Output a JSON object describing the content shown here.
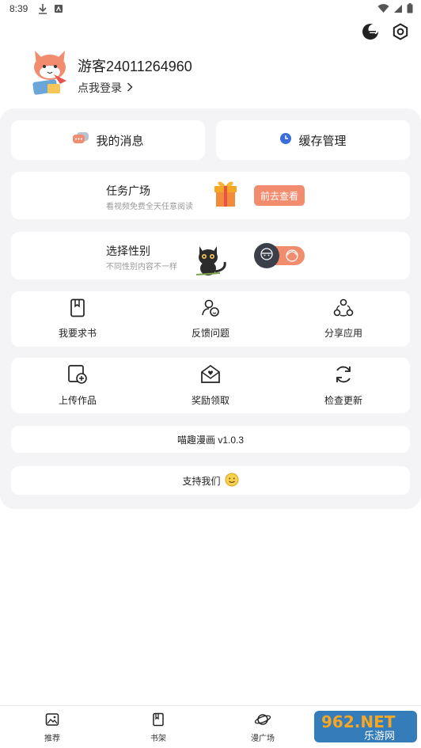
{
  "status": {
    "time": "8:39"
  },
  "profile": {
    "username": "游客24011264960",
    "login_label": "点我登录"
  },
  "quick": {
    "messages_label": "我的消息",
    "cache_label": "缓存管理"
  },
  "task": {
    "title": "任务广场",
    "subtitle": "看视频免费全天任意阅读",
    "button_label": "前去查看"
  },
  "gender": {
    "title": "选择性别",
    "subtitle": "不同性别内容不一样"
  },
  "grid1": [
    {
      "label": "我要求书",
      "icon": "book-icon"
    },
    {
      "label": "反馈问题",
      "icon": "feedback-icon"
    },
    {
      "label": "分享应用",
      "icon": "share-icon"
    }
  ],
  "grid2": [
    {
      "label": "上传作品",
      "icon": "upload-icon"
    },
    {
      "label": "奖励领取",
      "icon": "reward-icon"
    },
    {
      "label": "检查更新",
      "icon": "refresh-icon"
    }
  ],
  "version": {
    "text": "喵趣漫画  v1.0.3"
  },
  "support": {
    "label": "支持我们"
  },
  "nav": [
    {
      "label": "推荐",
      "icon": "image-icon"
    },
    {
      "label": "书架",
      "icon": "bookshelf-icon"
    },
    {
      "label": "漫广场",
      "icon": "planet-icon"
    }
  ],
  "watermark": {
    "text": "962.NET",
    "subtext": "乐游网"
  },
  "colors": {
    "accent": "#f28c6e",
    "panel": "#f4f4f6",
    "cache_dot": "#3b6fd8"
  }
}
